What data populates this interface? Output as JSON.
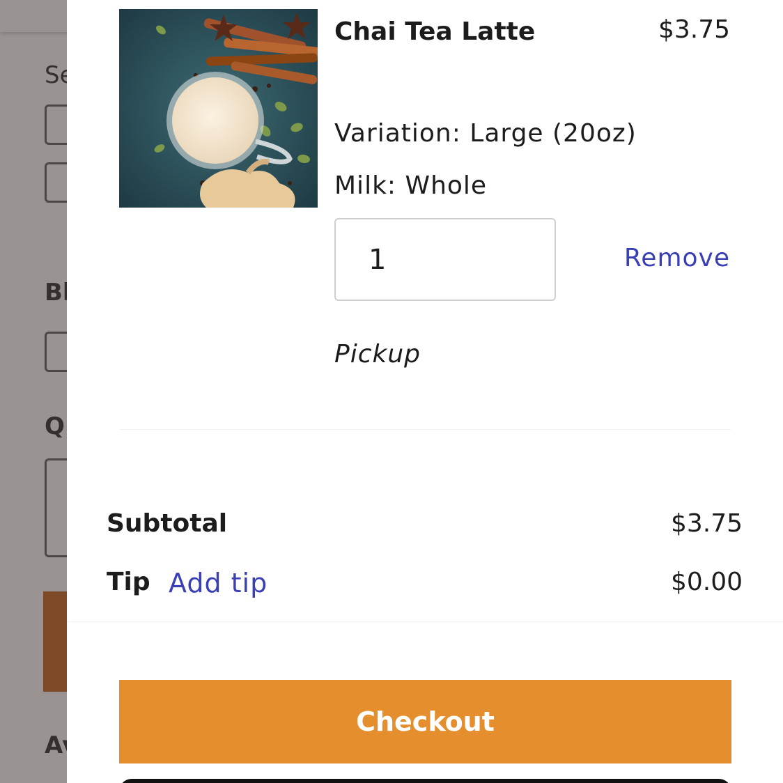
{
  "background": {
    "snippets": [
      "Se",
      "Bl",
      "Q",
      "Av"
    ]
  },
  "cart": {
    "item": {
      "name": "Chai Tea Latte",
      "price": "$3.75",
      "image_icon": "chai-latte-photo",
      "variation": "Variation: Large (20oz)",
      "milk": "Milk: Whole",
      "quantity": "1",
      "remove_label": "Remove",
      "fulfillment": "Pickup"
    },
    "summary": {
      "subtotal_label": "Subtotal",
      "subtotal_value": "$3.75",
      "tip_label": "Tip",
      "add_tip_label": "Add tip",
      "tip_value": "$0.00"
    },
    "checkout_label": "Checkout"
  },
  "colors": {
    "accent_orange": "#e48e2e",
    "link_blue": "#3a3fb5",
    "overlay_dim": "rgba(70,60,55,0.55)"
  }
}
